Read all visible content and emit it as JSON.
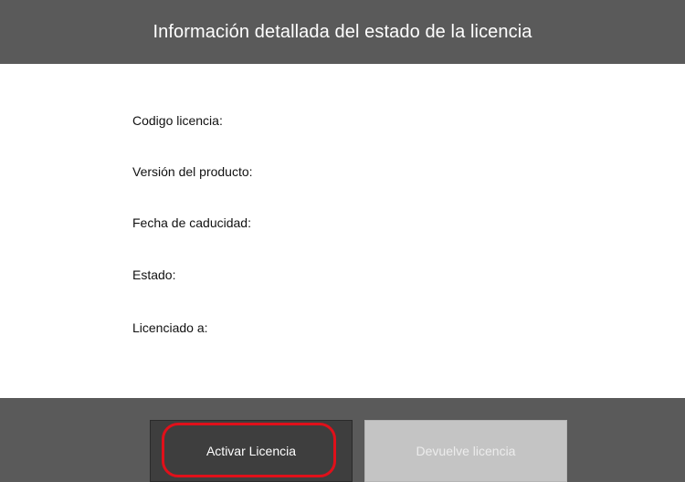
{
  "header": {
    "title": "Información detallada del estado de la licencia"
  },
  "fields": [
    {
      "label": "Codigo licencia:"
    },
    {
      "label": "Versión del producto:"
    },
    {
      "label": "Fecha de caducidad:"
    },
    {
      "label": "Estado:"
    },
    {
      "label": "Licenciado a:"
    }
  ],
  "footer": {
    "activate_label": "Activar Licencia",
    "return_label": "Devuelve licencia"
  },
  "colors": {
    "header_bg": "#5a5a5a",
    "footer_bg": "#5a5a5a",
    "activate_bg": "#3e3e3e",
    "return_bg_disabled": "#c4c4c4",
    "highlight_ring": "#e0101a"
  }
}
